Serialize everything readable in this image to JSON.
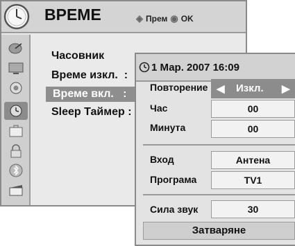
{
  "header": {
    "title": "ВРЕМЕ",
    "hint_move": "Прем",
    "hint_ok": "OK"
  },
  "menu": {
    "items": [
      {
        "label": "Часовник"
      },
      {
        "label": "Време изкл.  :"
      },
      {
        "label": "Време вкл.   :"
      },
      {
        "label": "Sleep Таймер :"
      }
    ],
    "selected_index": 2
  },
  "sidebar": {
    "icons": [
      "satellite-dish-icon",
      "monitor-icon",
      "speaker-icon",
      "clock-icon",
      "briefcase-icon",
      "lock-icon",
      "bluetooth-icon",
      "clapperboard-icon"
    ],
    "active_index": 3
  },
  "popup": {
    "datetime": "1 Мар. 2007 16:09",
    "repeat": {
      "label": "Повторение",
      "value": "Изкл."
    },
    "hour": {
      "label": "Час",
      "value": "00"
    },
    "minute": {
      "label": "Минута",
      "value": "00"
    },
    "input": {
      "label": "Вход",
      "value": "Антена"
    },
    "program": {
      "label": "Програма",
      "value": "TV1"
    },
    "volume": {
      "label": "Сила звук",
      "value": "30"
    },
    "close_label": "Затваряне"
  },
  "colors": {
    "selected_bg": "#8c8c8c",
    "panel_bg": "#e3e3e3"
  }
}
